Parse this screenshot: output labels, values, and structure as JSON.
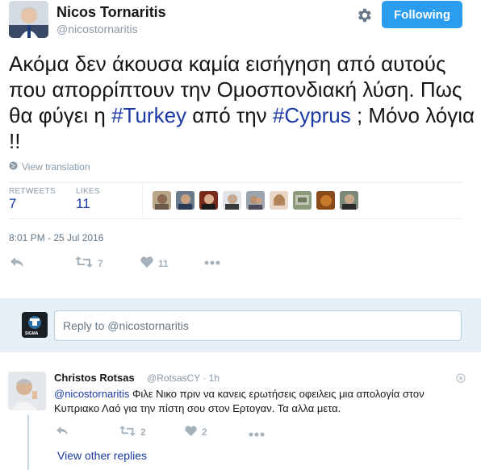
{
  "header": {
    "display_name": "Nicos Tornaritis",
    "handle": "@nicostornaritis",
    "follow_label": "Following"
  },
  "tweet": {
    "text_part1": "Ακόμα δεν άκουσα καμία εισήγηση από αυτούς που απορρίπτουν την Ομοσπονδιακή λύση. Πως θα φύγει η ",
    "hashtag1": "#Turkey",
    "text_part2": "  από την ",
    "hashtag2": "#Cyprus",
    "text_part3": " ; Μόνο λόγια  !!",
    "view_translation": "View translation"
  },
  "stats": {
    "retweets_label": "RETWEETS",
    "retweets_value": "7",
    "likes_label": "LIKES",
    "likes_value": "11"
  },
  "timestamp": "8:01 PM - 25 Jul 2016",
  "actions": {
    "retweet_count": "7",
    "like_count": "11"
  },
  "reply_box": {
    "placeholder": "Reply to @nicostornaritis",
    "avatar_text": "SIGMA"
  },
  "reply_tweet": {
    "name": "Christos Rotsas",
    "handle_time": "@RotsasCY · 1h",
    "mention": "@nicostornaritis",
    "text": " Φιλε Νικο πριν να κανεις ερωτήσεις οφειλεις μια απολογία στον Κυπριακο Λαό για την πίστη σου στον Ερτογαν. Τα αλλα μετα.",
    "retweet_count": "2",
    "like_count": "2",
    "view_replies": "View other replies"
  },
  "colors": {
    "accent": "#2b9df0",
    "link": "#1b3aa6",
    "muted": "#8899a6",
    "reply_bar": "#e8f0f7"
  }
}
